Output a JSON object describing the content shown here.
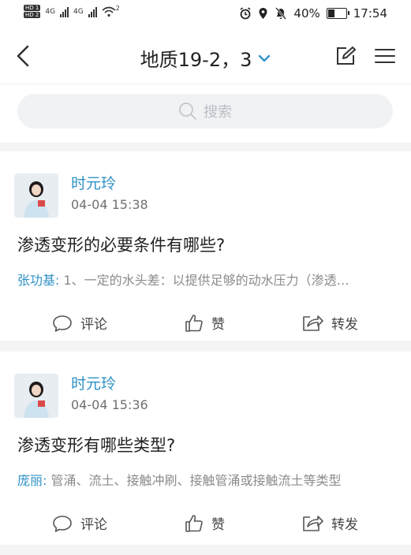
{
  "status_bar": {
    "signal_labels": [
      "HD 1",
      "HD 2"
    ],
    "network_1": "4G",
    "network_2": "4G",
    "wifi_sub": "2",
    "battery_percent": "40%",
    "battery_level": 0.4,
    "time": "17:54"
  },
  "nav": {
    "title": "地质19-2，3"
  },
  "search": {
    "placeholder": "搜索"
  },
  "posts": [
    {
      "author": "时元玲",
      "time": "04-04 15:38",
      "question": "渗透变形的必要条件有哪些?",
      "answer_author": "张功基:",
      "answer_text": "1、一定的水头差：以提供足够的动水压力（渗透…",
      "actions": {
        "comment": "评论",
        "like": "赞",
        "forward": "转发"
      }
    },
    {
      "author": "时元玲",
      "time": "04-04 15:36",
      "question": "渗透变形有哪些类型?",
      "answer_author": "庞丽:",
      "answer_text": "管涌、流土、接触冲刷、接触管涌或接触流土等类型",
      "actions": {
        "comment": "评论",
        "like": "赞",
        "forward": "转发"
      }
    }
  ],
  "colors": {
    "accent": "#2f92c7",
    "background": "#f4f4f4",
    "card": "#ffffff"
  }
}
